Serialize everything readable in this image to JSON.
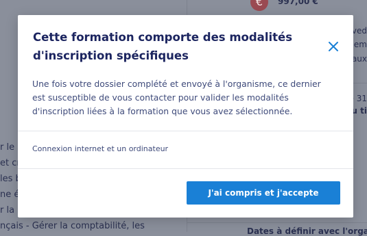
{
  "background": {
    "price": "997,00 €",
    "logo_glyph": "€",
    "left_lines": [
      "r le st",
      "et cré",
      "les b",
      "ne étu",
      "r la b",
      "nçais - Gérer la comptabilité, les"
    ],
    "right_lines": [
      {
        "text": "aved"
      },
      {
        "text": "glem"
      },
      {
        "text": "aux"
      },
      {
        "text": "e 31"
      },
      {
        "text": "u ti"
      }
    ],
    "bottom_right_text": "Dates à définir avec l'organis"
  },
  "modal": {
    "title": "Cette formation comporte des modalités d'inscription spécifiques",
    "description": "Une fois votre dossier complété et envoyé à l'organisme, ce dernier est susceptible de vous contacter pour valider les modalités d'inscription liées à la formation que vous avez sélectionnée.",
    "requirement": "Connexion internet et un ordinateur",
    "accept_label": "J'ai compris et j'accepte",
    "close_icon": "close-icon",
    "accent_color": "#1a80d6",
    "title_color": "#1c2560"
  }
}
